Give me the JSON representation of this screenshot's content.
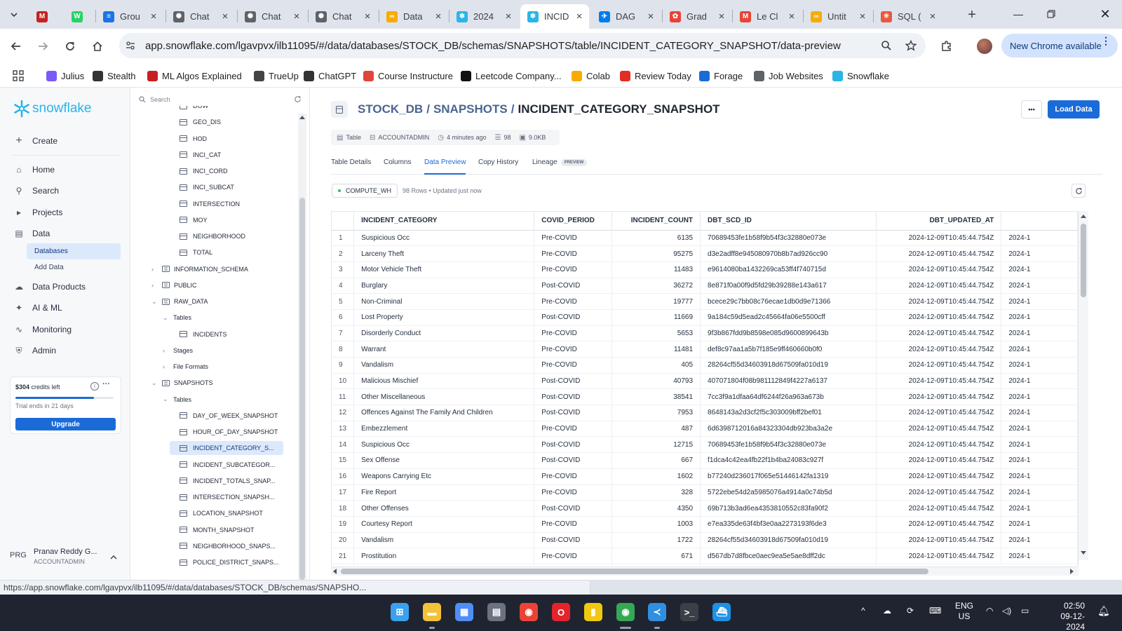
{
  "browser": {
    "tabs": [
      {
        "label": "",
        "color": "#c5221f",
        "glyph": "M"
      },
      {
        "label": "",
        "color": "#25d366",
        "glyph": "W"
      },
      {
        "label": "Grou",
        "color": "#1a73e8",
        "glyph": "≡"
      },
      {
        "label": "Chat",
        "color": "#5f6368",
        "glyph": "✺"
      },
      {
        "label": "Chat",
        "color": "#5f6368",
        "glyph": "✺"
      },
      {
        "label": "Chat",
        "color": "#5f6368",
        "glyph": "✺"
      },
      {
        "label": "Data",
        "color": "#f9ab00",
        "glyph": "∞"
      },
      {
        "label": "2024",
        "color": "#29b5e8",
        "glyph": "❄"
      },
      {
        "label": "INCID",
        "color": "#29b5e8",
        "glyph": "❄"
      },
      {
        "label": "DAG",
        "color": "#017cee",
        "glyph": "✈"
      },
      {
        "label": "Grad",
        "color": "#ea4335",
        "glyph": "✿"
      },
      {
        "label": "Le Cl",
        "color": "#ea4335",
        "glyph": "M"
      },
      {
        "label": "Untit",
        "color": "#f9ab00",
        "glyph": "∞"
      },
      {
        "label": "SQL (",
        "color": "#e8593d",
        "glyph": "✳"
      }
    ],
    "url": "app.snowflake.com/lgavpvx/ilb11095/#/data/databases/STOCK_DB/schemas/SNAPSHOTS/table/INCIDENT_CATEGORY_SNAPSHOT/data-preview",
    "chrome_available": "New Chrome available",
    "bookmarks": [
      {
        "label": "Julius",
        "icon": "julius-icon"
      },
      {
        "label": "Stealth",
        "icon": "stealth-icon"
      },
      {
        "label": "ML Algos Explained",
        "icon": "ml-algos-icon"
      },
      {
        "label": "TrueUp",
        "icon": "trueup-icon"
      },
      {
        "label": "ChatGPT",
        "icon": "chatgpt-icon"
      },
      {
        "label": "Course Instructure",
        "icon": "instructure-icon"
      },
      {
        "label": "Leetcode Company...",
        "icon": "github-icon"
      },
      {
        "label": "Colab",
        "icon": "colab-icon"
      },
      {
        "label": "Review Today",
        "icon": "youtube-icon"
      },
      {
        "label": "Forage",
        "icon": "forage-icon"
      },
      {
        "label": "Job Websites",
        "icon": "folder-icon"
      },
      {
        "label": "Snowflake",
        "icon": "snowflake-icon"
      }
    ],
    "status_url": "https://app.snowflake.com/lgavpvx/ilb11095/#/data/databases/STOCK_DB/schemas/SNAPSHO..."
  },
  "nav": {
    "logo": "snowflake",
    "create": "Create",
    "items": [
      {
        "label": "Home",
        "icon": "home-icon"
      },
      {
        "label": "Search",
        "icon": "search-icon"
      },
      {
        "label": "Projects",
        "icon": "projects-icon"
      },
      {
        "label": "Data",
        "icon": "data-icon"
      }
    ],
    "sub_items": [
      "Databases",
      "Add Data"
    ],
    "items2": [
      {
        "label": "Data Products",
        "icon": "cloud-icon"
      },
      {
        "label": "AI & ML",
        "icon": "sparkle-icon"
      },
      {
        "label": "Monitoring",
        "icon": "activity-icon"
      },
      {
        "label": "Admin",
        "icon": "shield-icon"
      }
    ],
    "credits": {
      "amount": "$304",
      "suffix": " credits left",
      "trial": "Trial ends in 21 days",
      "upgrade": "Upgrade",
      "used_fraction": 0.8
    },
    "user": {
      "initials": "PRG",
      "name": "Pranav Reddy G...",
      "role": "ACCOUNTADMIN"
    }
  },
  "explorer": {
    "search_placeholder": "Search",
    "nodes": [
      {
        "label": "DOW",
        "kind": "table",
        "indent": 2
      },
      {
        "label": "GEO_DIS",
        "kind": "table",
        "indent": 2
      },
      {
        "label": "HOD",
        "kind": "table",
        "indent": 2
      },
      {
        "label": "INCI_CAT",
        "kind": "table",
        "indent": 2
      },
      {
        "label": "INCI_CORD",
        "kind": "table",
        "indent": 2
      },
      {
        "label": "INCI_SUBCAT",
        "kind": "table",
        "indent": 2
      },
      {
        "label": "INTERSECTION",
        "kind": "table",
        "indent": 2
      },
      {
        "label": "MOY",
        "kind": "table",
        "indent": 2
      },
      {
        "label": "NEIGHBORHOOD",
        "kind": "table",
        "indent": 2
      },
      {
        "label": "TOTAL",
        "kind": "table",
        "indent": 2
      },
      {
        "label": "INFORMATION_SCHEMA",
        "kind": "schema",
        "indent": 0,
        "chev": "›"
      },
      {
        "label": "PUBLIC",
        "kind": "schema",
        "indent": 0,
        "chev": "›"
      },
      {
        "label": "RAW_DATA",
        "kind": "schema",
        "indent": 0,
        "chev": "⌄"
      },
      {
        "label": "Tables",
        "kind": "folder",
        "indent": 1,
        "chev": "⌄"
      },
      {
        "label": "INCIDENTS",
        "kind": "table",
        "indent": 2
      },
      {
        "label": "Stages",
        "kind": "folder",
        "indent": 1,
        "chev": "›"
      },
      {
        "label": "File Formats",
        "kind": "folder",
        "indent": 1,
        "chev": "›"
      },
      {
        "label": "SNAPSHOTS",
        "kind": "schema",
        "indent": 0,
        "chev": "⌄"
      },
      {
        "label": "Tables",
        "kind": "folder",
        "indent": 1,
        "chev": "⌄"
      },
      {
        "label": "DAY_OF_WEEK_SNAPSHOT",
        "kind": "table",
        "indent": 2
      },
      {
        "label": "HOUR_OF_DAY_SNAPSHOT",
        "kind": "table",
        "indent": 2
      },
      {
        "label": "INCIDENT_CATEGORY_S...",
        "kind": "table",
        "indent": 2,
        "selected": true
      },
      {
        "label": "INCIDENT_SUBCATEGOR...",
        "kind": "table",
        "indent": 2
      },
      {
        "label": "INCIDENT_TOTALS_SNAP...",
        "kind": "table",
        "indent": 2
      },
      {
        "label": "INTERSECTION_SNAPSH...",
        "kind": "table",
        "indent": 2
      },
      {
        "label": "LOCATION_SNAPSHOT",
        "kind": "table",
        "indent": 2
      },
      {
        "label": "MONTH_SNAPSHOT",
        "kind": "table",
        "indent": 2
      },
      {
        "label": "NEIGHBORHOOD_SNAPS...",
        "kind": "table",
        "indent": 2
      },
      {
        "label": "POLICE_DISTRICT_SNAPS...",
        "kind": "table",
        "indent": 2
      }
    ]
  },
  "main": {
    "breadcrumb": {
      "db": "STOCK_DB",
      "schema": "SNAPSHOTS",
      "table": "INCIDENT_CATEGORY_SNAPSHOT",
      "sep": "/"
    },
    "more": "•••",
    "load_data": "Load Data",
    "meta": {
      "type": "Table",
      "owner": "ACCOUNTADMIN",
      "updated": "4 minutes ago",
      "rows": "98",
      "size": "9.0KB"
    },
    "tabs": [
      "Table Details",
      "Columns",
      "Data Preview",
      "Copy History",
      "Lineage"
    ],
    "lineage_badge": "PREVIEW",
    "warehouse": "COMPUTE_WH",
    "rows_info": "98 Rows • Updated just now",
    "columns": [
      "",
      "INCIDENT_CATEGORY",
      "COVID_PERIOD",
      "INCIDENT_COUNT",
      "DBT_SCD_ID",
      "DBT_UPDATED_AT",
      ""
    ],
    "rows": [
      [
        "1",
        "Suspicious Occ",
        "Pre-COVID",
        "6135",
        "70689453fe1b58f9b54f3c32880e073e",
        "2024-12-09T10:45:44.754Z",
        "2024-1"
      ],
      [
        "2",
        "Larceny Theft",
        "Pre-COVID",
        "95275",
        "d3e2adff8e945080970b8b7ad926cc90",
        "2024-12-09T10:45:44.754Z",
        "2024-1"
      ],
      [
        "3",
        "Motor Vehicle Theft",
        "Pre-COVID",
        "11483",
        "e9614080ba1432269ca53ff4f740715d",
        "2024-12-09T10:45:44.754Z",
        "2024-1"
      ],
      [
        "4",
        "Burglary",
        "Post-COVID",
        "36272",
        "8e871f0a00f9d5fd29b39288e143a617",
        "2024-12-09T10:45:44.754Z",
        "2024-1"
      ],
      [
        "5",
        "Non-Criminal",
        "Pre-COVID",
        "19777",
        "bcece29c7bb08c76ecae1db0d9e71366",
        "2024-12-09T10:45:44.754Z",
        "2024-1"
      ],
      [
        "6",
        "Lost Property",
        "Post-COVID",
        "11669",
        "9a184c59d5ead2c45664fa06e5500cff",
        "2024-12-09T10:45:44.754Z",
        "2024-1"
      ],
      [
        "7",
        "Disorderly Conduct",
        "Pre-COVID",
        "5653",
        "9f3b867fdd9b8598e085d9600899643b",
        "2024-12-09T10:45:44.754Z",
        "2024-1"
      ],
      [
        "8",
        "Warrant",
        "Pre-COVID",
        "11481",
        "def8c97aa1a5b7f185e9ff460660b0f0",
        "2024-12-09T10:45:44.754Z",
        "2024-1"
      ],
      [
        "9",
        "Vandalism",
        "Pre-COVID",
        "405",
        "28264cf55d34603918d67509fa010d19",
        "2024-12-09T10:45:44.754Z",
        "2024-1"
      ],
      [
        "10",
        "Malicious Mischief",
        "Post-COVID",
        "40793",
        "407071804f08b981112849f4227a6137",
        "2024-12-09T10:45:44.754Z",
        "2024-1"
      ],
      [
        "11",
        "Other Miscellaneous",
        "Post-COVID",
        "38541",
        "7cc3f9a1dfaa64df6244f26a963a673b",
        "2024-12-09T10:45:44.754Z",
        "2024-1"
      ],
      [
        "12",
        "Offences Against The Family And Children",
        "Post-COVID",
        "7953",
        "8648143a2d3cf2f5c303009bff2bef01",
        "2024-12-09T10:45:44.754Z",
        "2024-1"
      ],
      [
        "13",
        "Embezzlement",
        "Pre-COVID",
        "487",
        "6d6398712016a84323304db923ba3a2e",
        "2024-12-09T10:45:44.754Z",
        "2024-1"
      ],
      [
        "14",
        "Suspicious Occ",
        "Post-COVID",
        "12715",
        "70689453fe1b58f9b54f3c32880e073e",
        "2024-12-09T10:45:44.754Z",
        "2024-1"
      ],
      [
        "15",
        "Sex Offense",
        "Post-COVID",
        "667",
        "f1dca4c42ea4fb22f1b4ba24083c927f",
        "2024-12-09T10:45:44.754Z",
        "2024-1"
      ],
      [
        "16",
        "Weapons Carrying Etc",
        "Pre-COVID",
        "1602",
        "b77240d236017f065e51446142fa1319",
        "2024-12-09T10:45:44.754Z",
        "2024-1"
      ],
      [
        "17",
        "Fire Report",
        "Pre-COVID",
        "328",
        "5722ebe54d2a5985076a4914a0c74b5d",
        "2024-12-09T10:45:44.754Z",
        "2024-1"
      ],
      [
        "18",
        "Other Offenses",
        "Post-COVID",
        "4350",
        "69b713b3ad6ea4353810552c83fa90f2",
        "2024-12-09T10:45:44.754Z",
        "2024-1"
      ],
      [
        "19",
        "Courtesy Report",
        "Pre-COVID",
        "1003",
        "e7ea335de63f4bf3e0aa2273193f6de3",
        "2024-12-09T10:45:44.754Z",
        "2024-1"
      ],
      [
        "20",
        "Vandalism",
        "Post-COVID",
        "1722",
        "28264cf55d34603918d67509fa010d19",
        "2024-12-09T10:45:44.754Z",
        "2024-1"
      ],
      [
        "21",
        "Prostitution",
        "Pre-COVID",
        "671",
        "d567db7d8fbce0aec9ea5e5ae8dff2dc",
        "2024-12-09T10:45:44.754Z",
        "2024-1"
      ]
    ]
  },
  "taskbar": {
    "apps": [
      {
        "icon": "windows-start-icon",
        "color": "#3aa0f0"
      },
      {
        "icon": "file-explorer-icon",
        "color": "#f3c13a"
      },
      {
        "icon": "microsoft-store-icon",
        "color": "#4f8ef7"
      },
      {
        "icon": "calculator-icon",
        "color": "#6b7280"
      },
      {
        "icon": "chrome-icon",
        "color": "#ea4335"
      },
      {
        "icon": "opera-icon",
        "color": "#e3242b"
      },
      {
        "icon": "power-bi-icon",
        "color": "#f2c811"
      },
      {
        "icon": "chrome-profile-icon",
        "color": "#34a853"
      },
      {
        "icon": "vscode-icon",
        "color": "#2f8fe0"
      },
      {
        "icon": "terminal-icon",
        "color": "#3b3f46"
      },
      {
        "icon": "docker-icon",
        "color": "#1d91e6"
      }
    ],
    "lang": "ENG",
    "region": "US",
    "time": "02:50",
    "date": "09-12-2024"
  }
}
